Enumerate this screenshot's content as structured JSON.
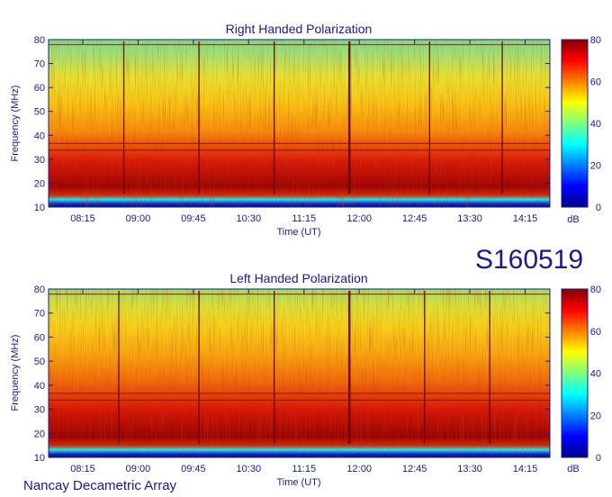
{
  "observation_id": "S160519",
  "footer": "Nancay Decametric Array",
  "chart_data": [
    {
      "type": "heatmap",
      "title": "Right Handed Polarization",
      "xlabel": "Time (UT)",
      "ylabel": "Frequency (MHz)",
      "x_ticks": [
        "08:15",
        "09:00",
        "09:45",
        "10:30",
        "11:15",
        "12:00",
        "12:45",
        "13:30",
        "14:15"
      ],
      "y_ticks": [
        10,
        20,
        30,
        40,
        50,
        60,
        70,
        80
      ],
      "ylim": [
        10,
        80
      ],
      "colorbar": {
        "label": "dB",
        "ticks": [
          0,
          20,
          40,
          60,
          80
        ],
        "range": [
          0,
          80
        ]
      },
      "approx_levels_by_frequency": [
        {
          "freq_mhz": 10,
          "db": 5
        },
        {
          "freq_mhz": 12,
          "db": 30
        },
        {
          "freq_mhz": 15,
          "db": 78
        },
        {
          "freq_mhz": 25,
          "db": 75
        },
        {
          "freq_mhz": 35,
          "db": 65
        },
        {
          "freq_mhz": 50,
          "db": 58
        },
        {
          "freq_mhz": 65,
          "db": 52
        },
        {
          "freq_mhz": 78,
          "db": 45
        }
      ]
    },
    {
      "type": "heatmap",
      "title": "Left Handed Polarization",
      "xlabel": "Time (UT)",
      "ylabel": "Frequency (MHz)",
      "x_ticks": [
        "08:15",
        "09:00",
        "09:45",
        "10:30",
        "11:15",
        "12:00",
        "12:45",
        "13:30",
        "14:15"
      ],
      "y_ticks": [
        10,
        20,
        30,
        40,
        50,
        60,
        70,
        80
      ],
      "ylim": [
        10,
        80
      ],
      "colorbar": {
        "label": "dB",
        "ticks": [
          0,
          20,
          40,
          60,
          80
        ],
        "range": [
          0,
          80
        ]
      },
      "approx_levels_by_frequency": [
        {
          "freq_mhz": 10,
          "db": 5
        },
        {
          "freq_mhz": 12,
          "db": 30
        },
        {
          "freq_mhz": 15,
          "db": 78
        },
        {
          "freq_mhz": 25,
          "db": 76
        },
        {
          "freq_mhz": 35,
          "db": 66
        },
        {
          "freq_mhz": 50,
          "db": 58
        },
        {
          "freq_mhz": 65,
          "db": 52
        },
        {
          "freq_mhz": 78,
          "db": 47
        }
      ]
    }
  ]
}
